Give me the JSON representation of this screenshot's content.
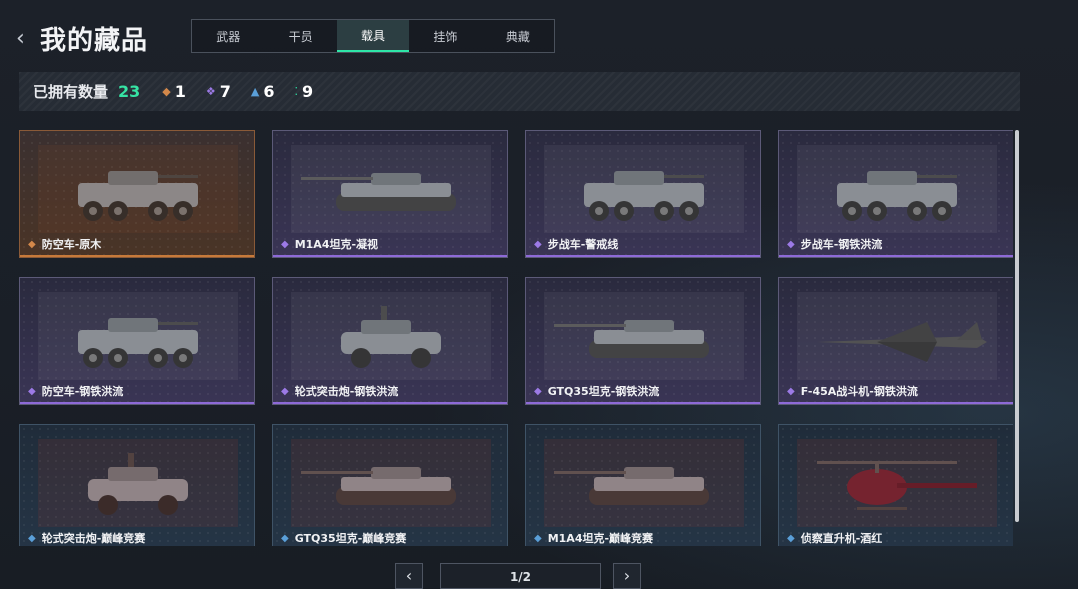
{
  "header": {
    "back_icon": "chevron-left-icon",
    "title": "我的藏品"
  },
  "tabs": [
    {
      "label": "武器",
      "active": false
    },
    {
      "label": "干员",
      "active": false
    },
    {
      "label": "载具",
      "active": true
    },
    {
      "label": "挂饰",
      "active": false
    },
    {
      "label": "典藏",
      "active": false
    }
  ],
  "stats": {
    "owned_label": "已拥有数量",
    "owned_count": "23",
    "rarities": [
      {
        "icon": "orange-diamond-icon",
        "count": "1",
        "color": "#d3884a"
      },
      {
        "icon": "purple-diamond-icon",
        "count": "7",
        "color": "#9c7ae6"
      },
      {
        "icon": "blue-chevron-icon",
        "count": "6",
        "color": "#5a9fd8"
      },
      {
        "icon": "green-dots-icon",
        "count": "9",
        "color": "#2ee6a8"
      }
    ]
  },
  "items": [
    {
      "name": "防空车-原木",
      "rarity": "orange",
      "kind": "apc"
    },
    {
      "name": "M1A4坦克-凝视",
      "rarity": "purple",
      "kind": "tank"
    },
    {
      "name": "步战车-警戒线",
      "rarity": "purple",
      "kind": "apc"
    },
    {
      "name": "步战车-钢铁洪流",
      "rarity": "purple",
      "kind": "apc"
    },
    {
      "name": "防空车-钢铁洪流",
      "rarity": "purple",
      "kind": "apc"
    },
    {
      "name": "轮式突击炮-钢铁洪流",
      "rarity": "purple",
      "kind": "jeep"
    },
    {
      "name": "GTQ35坦克-钢铁洪流",
      "rarity": "purple",
      "kind": "tank"
    },
    {
      "name": "F-45A战斗机-钢铁洪流",
      "rarity": "purple",
      "kind": "jet"
    },
    {
      "name": "轮式突击炮-巅峰竞赛",
      "rarity": "blue",
      "kind": "jeep"
    },
    {
      "name": "GTQ35坦克-巅峰竞赛",
      "rarity": "blue",
      "kind": "tank"
    },
    {
      "name": "M1A4坦克-巅峰竞赛",
      "rarity": "blue",
      "kind": "tank"
    },
    {
      "name": "侦察直升机-酒红",
      "rarity": "blue",
      "kind": "heli"
    }
  ],
  "pager": {
    "prev_icon": "chevron-left-icon",
    "next_icon": "chevron-right-icon",
    "page": "1/2"
  },
  "colors": {
    "accent": "#2ee6a8",
    "orange": "#d3884a",
    "purple": "#9c7ae6",
    "blue": "#5a9fd8"
  }
}
